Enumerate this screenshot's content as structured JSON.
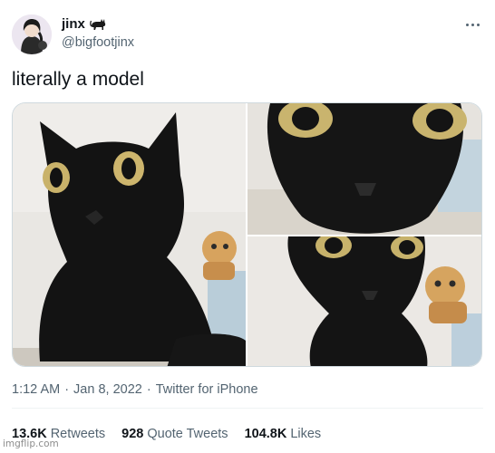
{
  "author": {
    "display_name": "jinx",
    "name_emoji": "black-cat-emoji",
    "handle": "@bigfootjinx",
    "avatar": "avatar-image"
  },
  "tweet": {
    "text": "literally a model"
  },
  "media": {
    "photos": [
      "black-cat-closeup-photo",
      "black-cat-face-closeup-photo",
      "black-cat-with-plush-photo"
    ]
  },
  "meta": {
    "time": "1:12 AM",
    "separator_1": "·",
    "date": "Jan 8, 2022",
    "separator_2": "·",
    "source": "Twitter for iPhone"
  },
  "stats": {
    "retweets_count": "13.6K",
    "retweets_label": "Retweets",
    "quotes_count": "928",
    "quotes_label": "Quote Tweets",
    "likes_count": "104.8K",
    "likes_label": "Likes"
  },
  "watermark": "imgflip.com",
  "colors": {
    "text_primary": "#0f1419",
    "text_secondary": "#536471",
    "border": "#cfd9de"
  }
}
